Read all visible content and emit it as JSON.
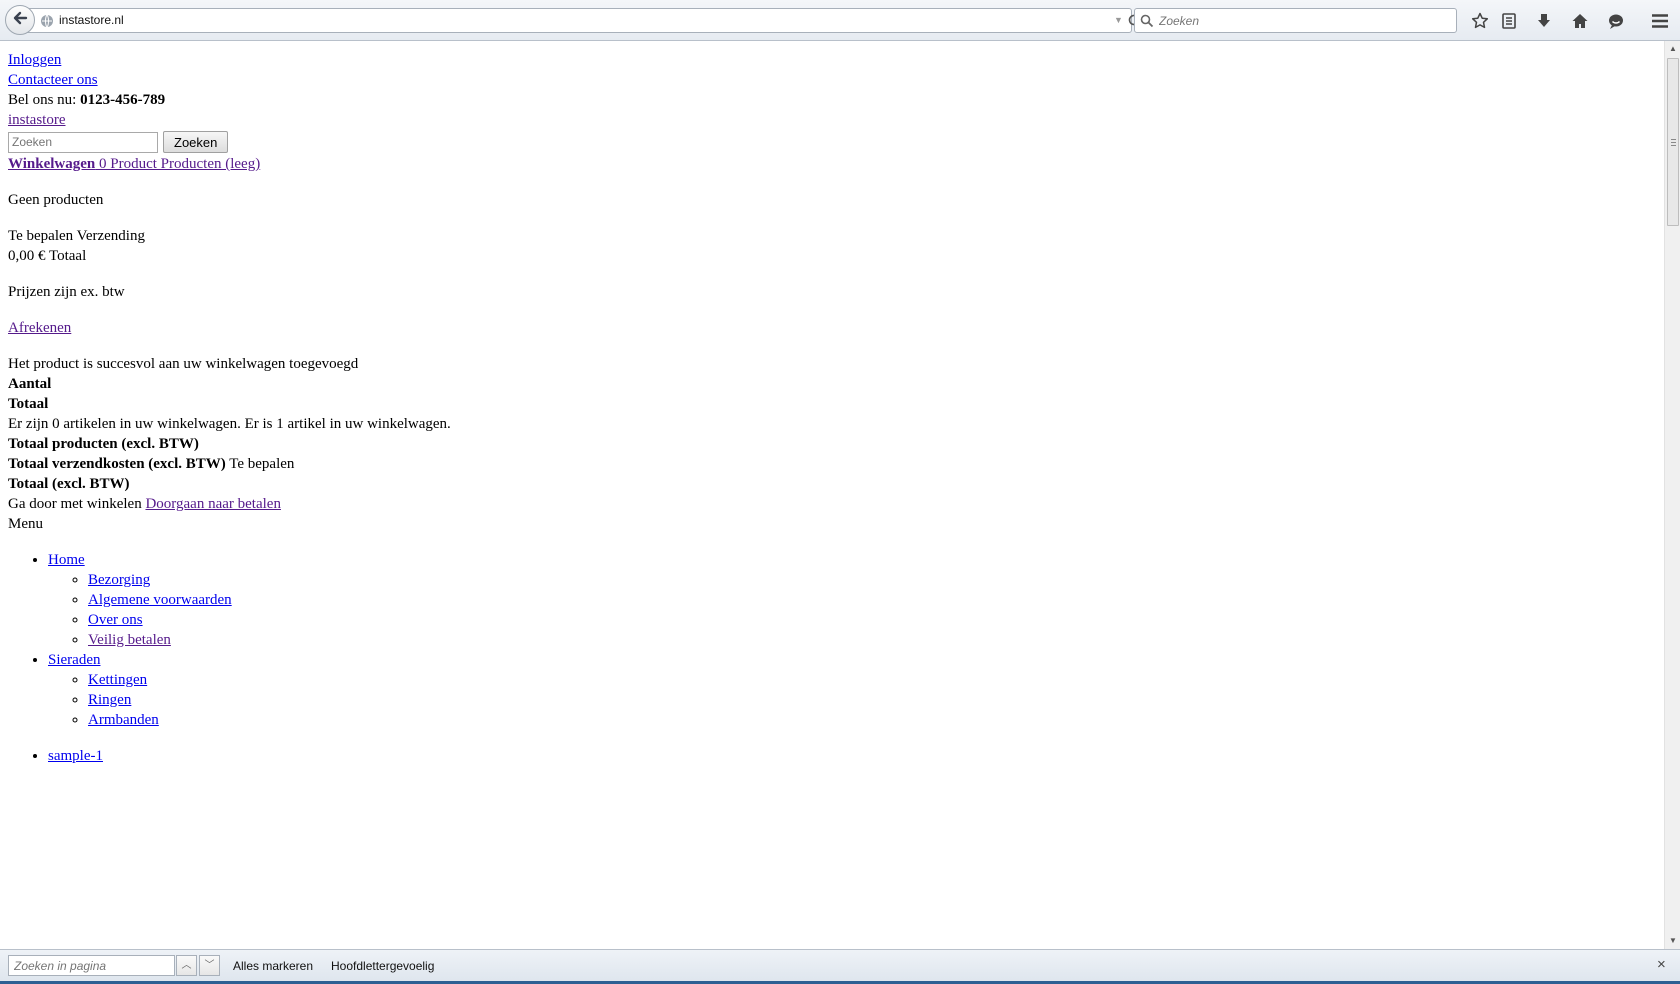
{
  "browser": {
    "url": "instastore.nl",
    "search_placeholder": "Zoeken"
  },
  "header": {
    "login_link": "Inloggen",
    "contact_link": "Contacteer ons",
    "call_label": "Bel ons nu:",
    "phone": "0123-456-789",
    "logo_link": "instastore",
    "search_placeholder": "Zoeken",
    "search_button": "Zoeken"
  },
  "cart": {
    "title": "Winkelwagen",
    "summary": "0 Product Producten (leeg)",
    "no_products": "Geen producten",
    "shipping": "Te bepalen Verzending",
    "total": "0,00 € Totaal",
    "prices_note": "Prijzen zijn ex. btw",
    "checkout_link": "Afrekenen"
  },
  "layer_cart": {
    "success_message": "Het product is succesvol aan uw winkelwagen toegevoegd",
    "quantity_label": "Aantal",
    "total_label": "Totaal",
    "count_text": "Er zijn 0 artikelen in uw winkelwagen. Er is 1 artikel in uw winkelwagen.",
    "total_products_label": "Totaal producten (excl. BTW)",
    "total_shipping_label": "Totaal verzendkosten (excl. BTW)",
    "total_shipping_value": "Te bepalen",
    "total_excl_label": "Totaal (excl. BTW)",
    "continue_text": "Ga door met winkelen",
    "proceed_link": "Doorgaan naar betalen",
    "menu_label": "Menu"
  },
  "menu": [
    {
      "label": "Home",
      "children": [
        "Bezorging",
        "Algemene voorwaarden",
        "Over ons",
        "Veilig betalen"
      ]
    },
    {
      "label": "Sieraden",
      "children": [
        "Kettingen",
        "Ringen",
        "Armbanden"
      ]
    },
    {
      "label": "sample-1",
      "children": []
    }
  ],
  "findbar": {
    "placeholder": "Zoeken in pagina",
    "highlight_all": "Alles markeren",
    "match_case": "Hoofdlettergevoelig"
  },
  "colors": {
    "link": "#0000ee",
    "visited_link": "#551a8b"
  }
}
